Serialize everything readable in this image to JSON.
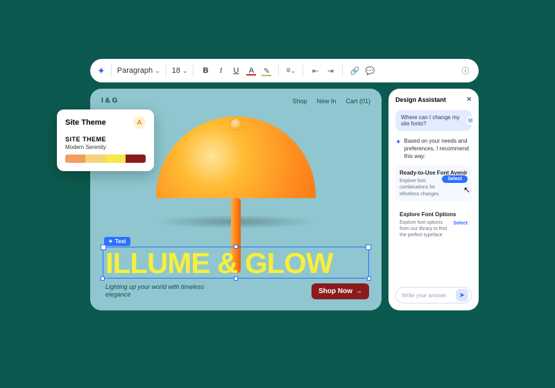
{
  "toolbar": {
    "style_label": "Paragraph",
    "font_size": "18",
    "bold": "B",
    "italic": "I",
    "underline": "U",
    "colorA": "A",
    "highlight": "✎"
  },
  "theme_card": {
    "title": "Site Theme",
    "subtitle": "SITE THEME",
    "name": "Modern Serenity",
    "colors": [
      "#f19e5f",
      "#f6d27a",
      "#f6e94b",
      "#8c1c1c"
    ]
  },
  "hero": {
    "logo": "I & G",
    "nav": {
      "shop": "Shop",
      "new_in": "New In",
      "cart": "Cart (01)"
    },
    "text_pill": "Text",
    "title": "ILLUME & GLOW",
    "tagline": "Lighting up your world with timeless elegance",
    "cta": "Shop Now"
  },
  "assistant": {
    "title": "Design Assistant",
    "user_message": "Where can I change my site fonts?",
    "user_initial": "M",
    "ai_intro": "Based on your needs and preferences, I recommend this way:",
    "rec1": {
      "title": "Ready-to-Use Font Avenir",
      "desc": "Explore font combinations for effortless changes",
      "action": "Select"
    },
    "rec2": {
      "title": "Explore Font Options",
      "desc": "Explore font options from our library to find the perfect typeface",
      "action": "Select"
    },
    "composer_placeholder": "Write your answer"
  }
}
